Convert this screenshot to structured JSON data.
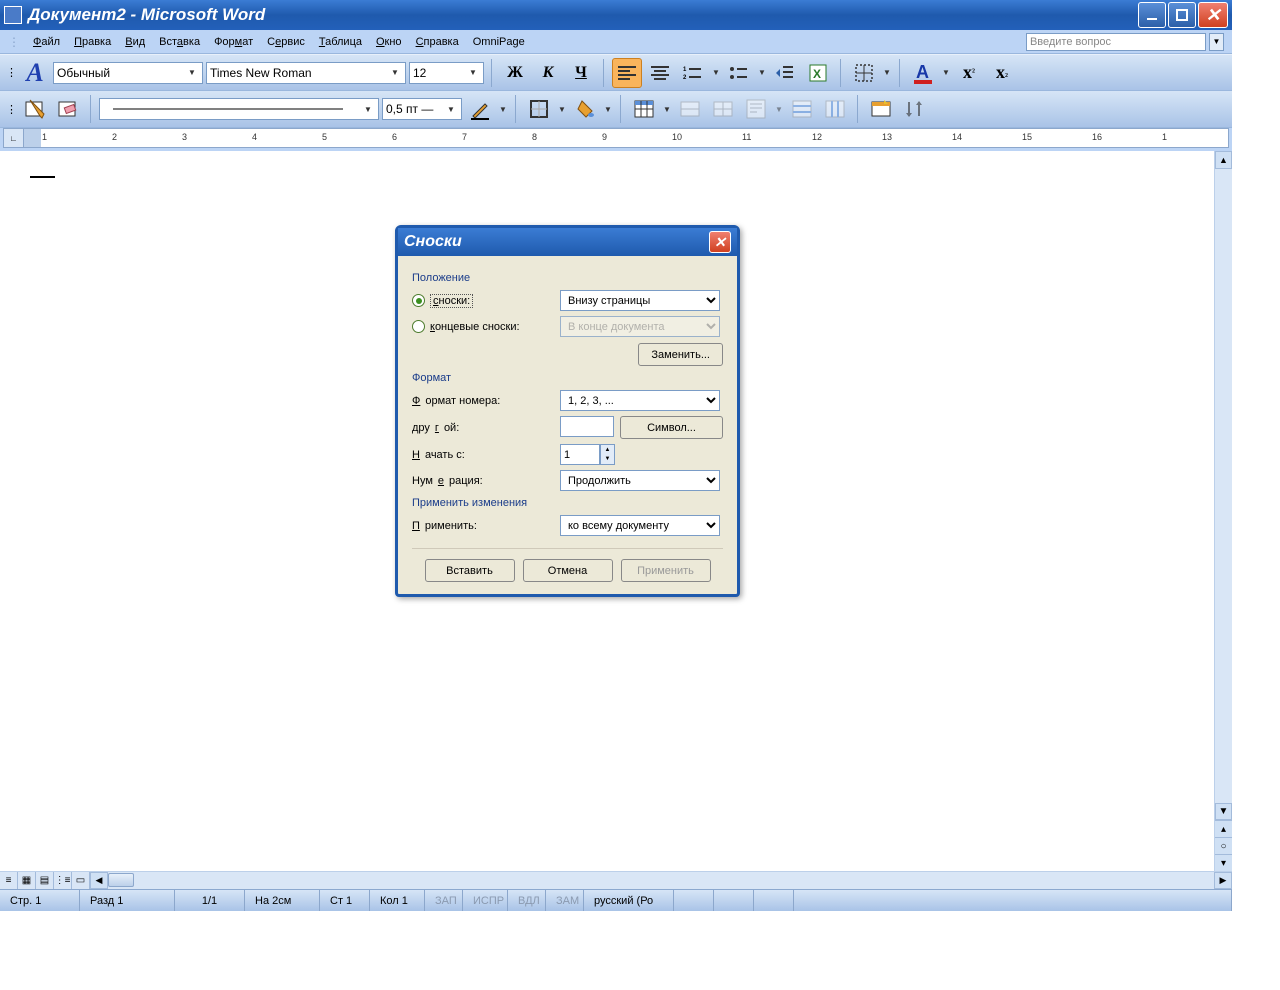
{
  "title": "Документ2 - Microsoft Word",
  "menu": {
    "file": "Файл",
    "edit": "Правка",
    "view": "Вид",
    "insert": "Вставка",
    "format": "Формат",
    "tools": "Сервис",
    "table": "Таблица",
    "window": "Окно",
    "help": "Справка",
    "omni": "OmniPage"
  },
  "help_placeholder": "Введите вопрос",
  "toolbar1": {
    "style": "Обычный",
    "font": "Times New Roman",
    "size": "12",
    "bold": "Ж",
    "italic": "К",
    "underline": "Ч"
  },
  "toolbar2": {
    "linewidth": "0,5 пт"
  },
  "ruler_nums": [
    "1",
    "2",
    "3",
    "4",
    "5",
    "6",
    "7",
    "8",
    "9",
    "10",
    "11",
    "12",
    "13",
    "14",
    "15",
    "16",
    "1"
  ],
  "dialog": {
    "title": "Сноски",
    "position_label": "Положение",
    "footnotes_radio": "сноски:",
    "footnotes_loc": "Внизу страницы",
    "endnotes_radio": "концевые сноски:",
    "endnotes_loc": "В конце документа",
    "replace": "Заменить...",
    "format_label": "Формат",
    "num_format_label": "Формат номера:",
    "num_format": "1, 2, 3, ...",
    "custom_label": "другой:",
    "symbol": "Символ...",
    "start_label": "Начать с:",
    "start": "1",
    "numbering_label": "Нумерация:",
    "numbering": "Продолжить",
    "apply_grp": "Применить изменения",
    "apply_to_label": "Применить:",
    "apply_to": "ко всему документу",
    "insert": "Вставить",
    "cancel": "Отмена",
    "apply": "Применить"
  },
  "status": {
    "page": "Стр. 1",
    "sect": "Разд 1",
    "pages": "1/1",
    "at": "На 2см",
    "line": "Ст 1",
    "col": "Кол 1",
    "rec": "ЗАП",
    "trk": "ИСПР",
    "ext": "ВДЛ",
    "ovr": "ЗАМ",
    "lang": "русский (Ро"
  }
}
